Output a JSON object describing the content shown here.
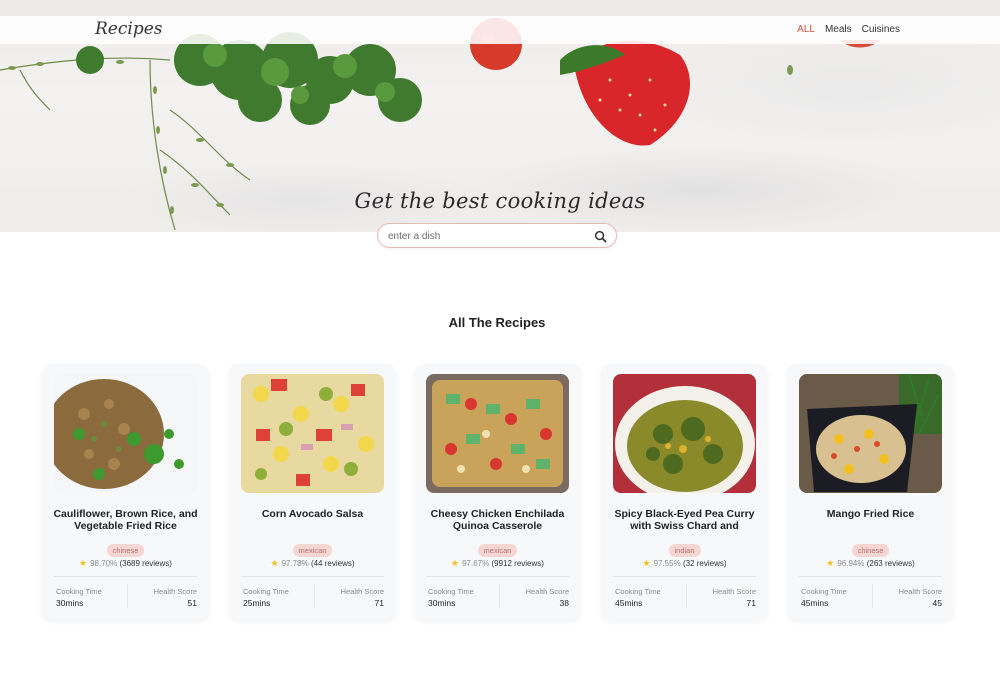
{
  "header": {
    "brand": "Recipes",
    "nav": [
      {
        "label": "ALL",
        "active": true
      },
      {
        "label": "Meals",
        "active": false
      },
      {
        "label": "Cuisines",
        "active": false
      }
    ]
  },
  "hero": {
    "headline": "Get the best cooking ideas",
    "search_placeholder": "enter a dish",
    "search_icon": "search-icon"
  },
  "section_title": "All The Recipes",
  "colors": {
    "accent": "#d0533a",
    "tag_bg": "#f5d6d3",
    "tag_text": "#b7706b",
    "star": "#f4c020"
  },
  "recipes": [
    {
      "title": "Cauliflower, Brown Rice, and Vegetable Fried Rice",
      "cuisine": "chinese",
      "rating_pct": "98.70%",
      "reviews": "(3689 reviews)",
      "cooking_time_label": "Cooking Time",
      "cooking_time": "30mins",
      "health_label": "Health Score",
      "health_score": "51"
    },
    {
      "title": "Corn Avocado Salsa",
      "cuisine": "mexican",
      "rating_pct": "97.78%",
      "reviews": "(44 reviews)",
      "cooking_time_label": "Cooking Time",
      "cooking_time": "25mins",
      "health_label": "Health Score",
      "health_score": "71"
    },
    {
      "title": "Cheesy Chicken Enchilada Quinoa Casserole",
      "cuisine": "mexican",
      "rating_pct": "97.67%",
      "reviews": "(9912 reviews)",
      "cooking_time_label": "Cooking Time",
      "cooking_time": "30mins",
      "health_label": "Health Score",
      "health_score": "38"
    },
    {
      "title": "Spicy Black-Eyed Pea Curry with Swiss Chard and",
      "cuisine": "indian",
      "rating_pct": "97.55%",
      "reviews": "(32 reviews)",
      "cooking_time_label": "Cooking Time",
      "cooking_time": "45mins",
      "health_label": "Health Score",
      "health_score": "71"
    },
    {
      "title": "Mango Fried Rice",
      "cuisine": "chinese",
      "rating_pct": "96.94%",
      "reviews": "(263 reviews)",
      "cooking_time_label": "Cooking Time",
      "cooking_time": "45mins",
      "health_label": "Health Score",
      "health_score": "45"
    }
  ]
}
